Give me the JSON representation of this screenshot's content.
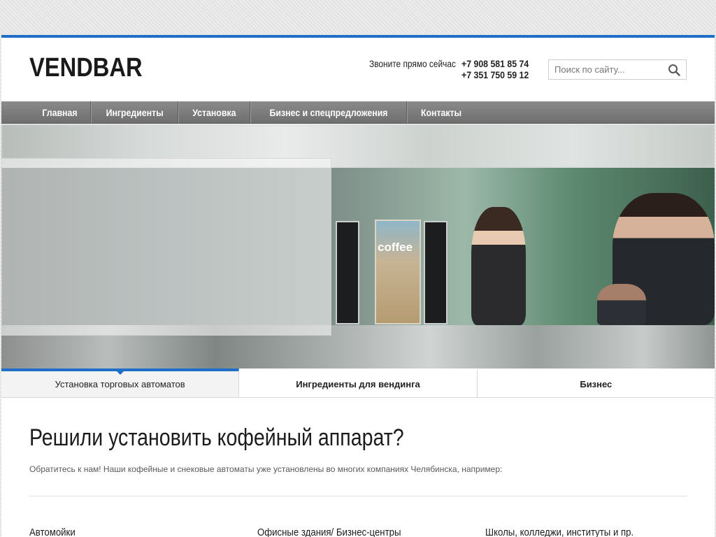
{
  "logo": "VENDBAR",
  "contact": {
    "label": "Звоните прямо сейчас",
    "phone1": "+7 908 581 85 74",
    "phone2": "+7 351 750 59 12"
  },
  "search": {
    "placeholder": "Поиск по сайту..."
  },
  "nav": {
    "items": [
      {
        "label": "Главная"
      },
      {
        "label": "Ингредиенты"
      },
      {
        "label": "Установка"
      },
      {
        "label": "Бизнес и спецпредложения"
      },
      {
        "label": "Контакты"
      }
    ]
  },
  "hero": {
    "coffee_text": "coffee"
  },
  "tabs": [
    {
      "label": "Установка торговых автоматов",
      "active": true
    },
    {
      "label": "Ингредиенты для вендинга",
      "active": false
    },
    {
      "label": "Бизнес",
      "active": false
    }
  ],
  "main": {
    "title": "Решили установить кофейный аппарат?",
    "intro": "Обратитесь к нам! Наши кофейные и снековые автоматы уже установлены во многих компаниях Челябинска, например:",
    "columns": [
      {
        "label": "Автомойки"
      },
      {
        "label": "Офисные здания/ Бизнес-центры"
      },
      {
        "label": "Школы, колледжи, институты и пр."
      }
    ]
  },
  "colors": {
    "accent": "#1f6fc9",
    "nav_bg": "#7a7a7a"
  },
  "icons": {
    "search": "search-icon"
  }
}
